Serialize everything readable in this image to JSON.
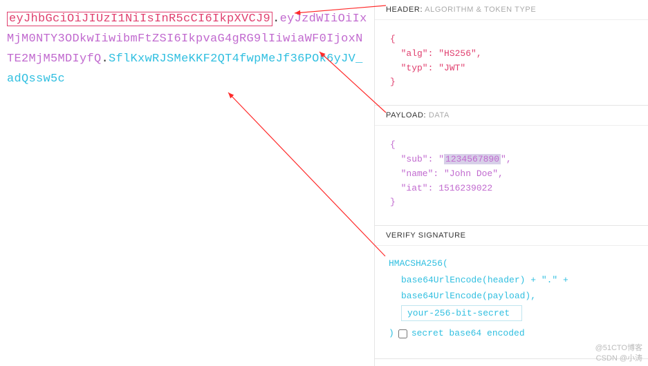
{
  "token": {
    "header": "eyJhbGciOiJIUzI1NiIsInR5cCI6IkpXVCJ9",
    "payload": "eyJzdWIiOiIxMjM0NTY3ODkwIiwibmFtZSI6IkpvaG4gRG9lIiwiaWF0IjoxNTE2MjM5MDIyfQ",
    "signature": "SflKxwRJSMeKKF2QT4fwpMeJf36POk6yJV_adQssw5c"
  },
  "sections": {
    "header": {
      "title": "HEADER:",
      "subtitle": "ALGORITHM & TOKEN TYPE",
      "json": "{\n  \"alg\": \"HS256\",\n  \"typ\": \"JWT\"\n}"
    },
    "payload": {
      "title": "PAYLOAD:",
      "subtitle": "DATA",
      "json_prefix": "{\n  \"sub\": \"",
      "sub_value": "1234567890",
      "json_suffix": "\",\n  \"name\": \"John Doe\",\n  \"iat\": 1516239022\n}"
    },
    "verify": {
      "title": "VERIFY SIGNATURE",
      "fn": "HMACSHA256(",
      "line1": "base64UrlEncode(header) + \".\" +",
      "line2": "base64UrlEncode(payload),",
      "secret_value": "your-256-bit-secret",
      "closing_paren": ")",
      "checkbox_label": "secret base64 encoded"
    }
  },
  "watermark": {
    "line1": "@51CTO博客",
    "line2": "CSDN @小涛"
  }
}
